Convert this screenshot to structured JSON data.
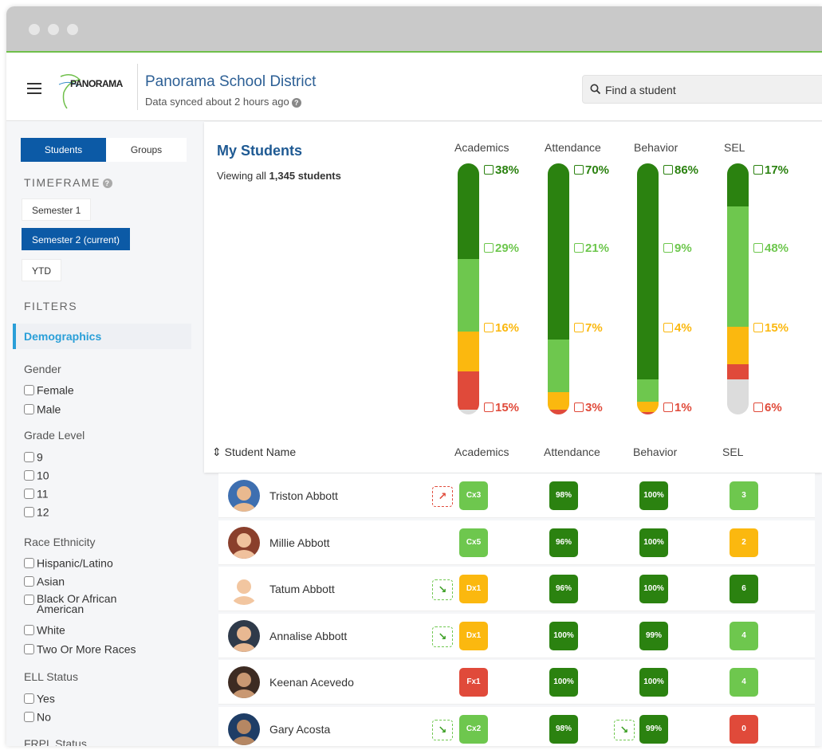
{
  "header": {
    "logo_text": "PANORAMA",
    "district_name": "Panorama School District",
    "sync_status": "Data synced about 2 hours ago",
    "search_placeholder": "Find a student"
  },
  "sidebar": {
    "tabs": [
      "Students",
      "Groups"
    ],
    "timeframe_label": "TIMEFRAME",
    "timeframes": [
      "Semester 1",
      "Semester 2 (current)",
      "YTD"
    ],
    "selected_timeframe": "Semester 2 (current)",
    "filters_label": "FILTERS",
    "filter_tab": "Demographics",
    "groups": [
      {
        "label": "Gender",
        "options": [
          "Female",
          "Male"
        ]
      },
      {
        "label": "Grade Level",
        "options": [
          "9",
          "10",
          "11",
          "12"
        ]
      },
      {
        "label": "Race Ethnicity",
        "options": [
          "Hispanic/Latino",
          "Asian",
          "Black Or African American",
          "White",
          "Two Or More Races"
        ]
      },
      {
        "label": "ELL Status",
        "options": [
          "Yes",
          "No"
        ]
      },
      {
        "label": "FRPL Status",
        "options": []
      }
    ]
  },
  "summary": {
    "title": "My Students",
    "viewing_prefix": "Viewing all",
    "student_count": "1,345 students",
    "categories": [
      {
        "name": "Academics",
        "levels": [
          38,
          29,
          16,
          15
        ],
        "labels": [
          "38%",
          "29%",
          "16%",
          "15%"
        ]
      },
      {
        "name": "Attendance",
        "levels": [
          70,
          21,
          7,
          3
        ],
        "labels": [
          "70%",
          "21%",
          "7%",
          "3%"
        ]
      },
      {
        "name": "Behavior",
        "levels": [
          86,
          9,
          4,
          1
        ],
        "labels": [
          "86%",
          "9%",
          "4%",
          "1%"
        ]
      },
      {
        "name": "SEL",
        "levels": [
          17,
          48,
          15,
          6
        ],
        "labels": [
          "17%",
          "48%",
          "15%",
          "6%"
        ]
      }
    ]
  },
  "table": {
    "name_header": "Student Name",
    "columns": [
      "Academics",
      "Attendance",
      "Behavior",
      "SEL"
    ],
    "rows": [
      {
        "name": "Triston Abbott",
        "academics": "Cx3",
        "attendance": "98%",
        "behavior": "100%",
        "sel": "3",
        "trend": "up"
      },
      {
        "name": "Millie Abbott",
        "academics": "Cx5",
        "attendance": "96%",
        "behavior": "100%",
        "sel": "2",
        "trend": ""
      },
      {
        "name": "Tatum Abbott",
        "academics": "Dx1",
        "attendance": "96%",
        "behavior": "100%",
        "sel": "6",
        "trend": "down"
      },
      {
        "name": "Annalise Abbott",
        "academics": "Dx1",
        "attendance": "100%",
        "behavior": "99%",
        "sel": "4",
        "trend": "down"
      },
      {
        "name": "Keenan Acevedo",
        "academics": "Fx1",
        "attendance": "100%",
        "behavior": "100%",
        "sel": "4",
        "trend": ""
      },
      {
        "name": "Gary Acosta",
        "academics": "Cx2",
        "attendance": "98%",
        "behavior": "99%",
        "sel": "0",
        "trend": "down"
      }
    ]
  },
  "colors": {
    "dark_green": "#2b8210",
    "light_green": "#6ec74e",
    "yellow": "#fbb80f",
    "red": "#e04a3a",
    "gray": "#dcdcdc",
    "primary_blue": "#0c5aa6"
  }
}
